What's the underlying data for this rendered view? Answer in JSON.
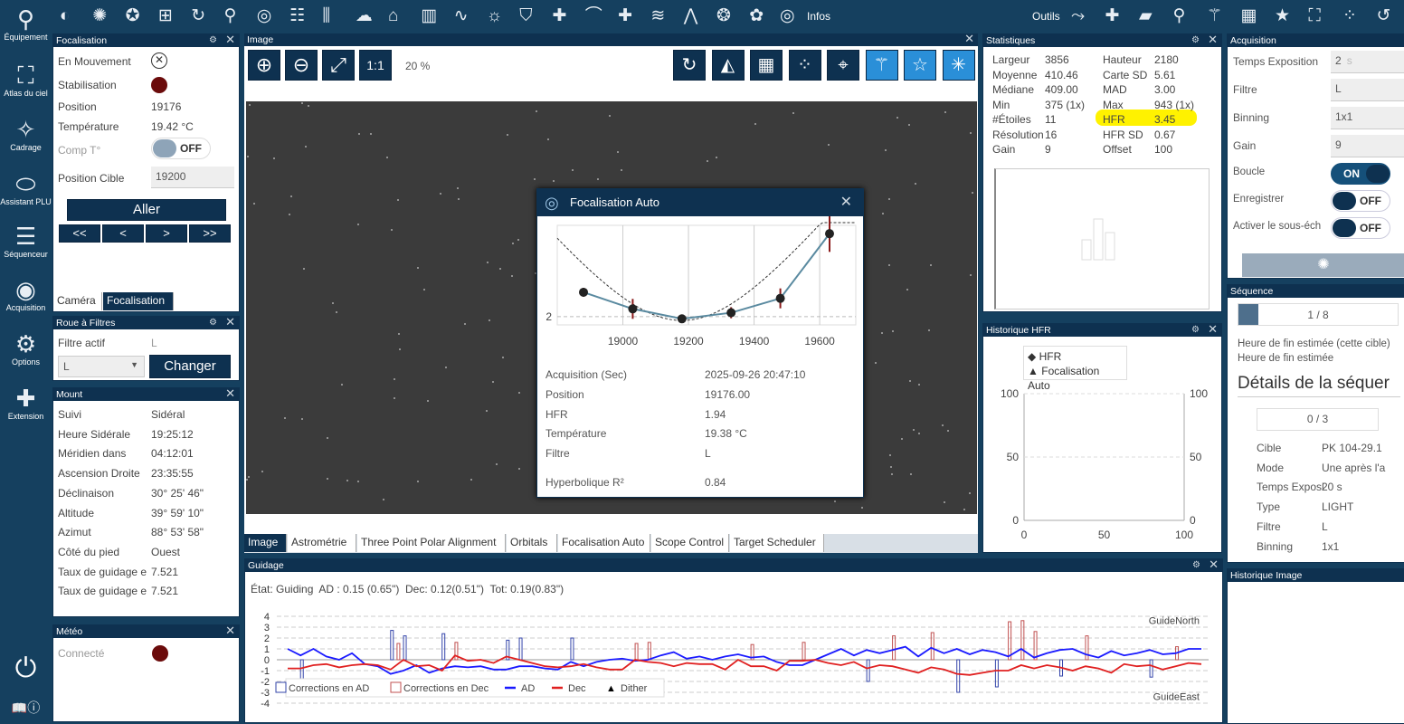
{
  "colors": {
    "navy": "#0e3150",
    "sidebar": "#15405f",
    "ad": "#1a1aff",
    "dec": "#e02020",
    "highlight": "#fff200",
    "fail": "#6b0b0b"
  },
  "sidebar": {
    "items": [
      {
        "label": "Équipement",
        "icon": "telescope-icon",
        "glyph": "⚲"
      },
      {
        "label": "Atlas du ciel",
        "icon": "map-icon",
        "glyph": "⛶"
      },
      {
        "label": "Cadrage",
        "icon": "stars-icon",
        "glyph": "✧"
      },
      {
        "label": "Assistant PLU",
        "icon": "flat-panel-icon",
        "glyph": "⬭"
      },
      {
        "label": "Séquenceur",
        "icon": "list-stars-icon",
        "glyph": "☰"
      },
      {
        "label": "Acquisition",
        "icon": "constellation-icon",
        "glyph": "◉"
      },
      {
        "label": "Options",
        "icon": "gears-icon",
        "glyph": "⚙"
      },
      {
        "label": "Extension",
        "icon": "puzzle-icon",
        "glyph": "✚"
      }
    ],
    "power": "⏻",
    "book": "📖",
    "info": "ⓘ"
  },
  "toolbar": {
    "left_icons": [
      {
        "name": "sky-icon",
        "glyph": "◐"
      },
      {
        "name": "shutter-icon",
        "glyph": "✺"
      },
      {
        "name": "filter-wheel-icon",
        "glyph": "✪"
      },
      {
        "name": "framing-icon",
        "glyph": "⊞"
      },
      {
        "name": "rotator-icon",
        "glyph": "↻"
      },
      {
        "name": "telescope-icon",
        "glyph": "⚲"
      },
      {
        "name": "guider-icon",
        "glyph": "◎"
      },
      {
        "name": "switch-list-icon",
        "glyph": "☷"
      },
      {
        "name": "sliders-icon",
        "glyph": "⫼"
      },
      {
        "name": "weather-icon",
        "glyph": "☁"
      },
      {
        "name": "dome-icon",
        "glyph": "⌂"
      },
      {
        "name": "chart-icon",
        "glyph": "▥"
      },
      {
        "name": "graph-icon",
        "glyph": "∿"
      },
      {
        "name": "bulb-icon",
        "glyph": "☼"
      },
      {
        "name": "shield-icon",
        "glyph": "⛉"
      },
      {
        "name": "plugin-icon",
        "glyph": "✚"
      },
      {
        "name": "curve-icon",
        "glyph": "⌒"
      },
      {
        "name": "puzzle-icon",
        "glyph": "✚"
      },
      {
        "name": "layers-icon",
        "glyph": "≋"
      },
      {
        "name": "horizon-icon",
        "glyph": "⋀"
      },
      {
        "name": "wheel-icon",
        "glyph": "❂"
      },
      {
        "name": "gear-flower-icon",
        "glyph": "✿"
      }
    ],
    "info_label": "Infos",
    "tools_label": "Outils",
    "right_icons": [
      {
        "name": "constellation-tool-icon",
        "glyph": "⤳"
      },
      {
        "name": "crosshair-tool-icon",
        "glyph": "✚"
      },
      {
        "name": "flat-tool-icon",
        "glyph": "▰"
      },
      {
        "name": "search-star-icon",
        "glyph": "⚲"
      },
      {
        "name": "wand-icon",
        "glyph": "⚚"
      },
      {
        "name": "calculator-icon",
        "glyph": "▦"
      },
      {
        "name": "star-icon",
        "glyph": "★"
      },
      {
        "name": "af-icon",
        "glyph": "⛶"
      },
      {
        "name": "star-field-icon",
        "glyph": "⁘"
      },
      {
        "name": "history-icon",
        "glyph": "↺"
      }
    ]
  },
  "focuser": {
    "title": "Focalisation",
    "rows": [
      {
        "label": "En Mouvement",
        "value": ""
      },
      {
        "label": "Stabilisation",
        "value": ""
      },
      {
        "label": "Position",
        "value": "19176"
      },
      {
        "label": "Température",
        "value": "19.42 °C"
      },
      {
        "label": "Comp T°",
        "value": ""
      },
      {
        "label": "Position Cible",
        "value": ""
      }
    ],
    "comp_toggle": "OFF",
    "target_value": "19200",
    "go_label": "Aller",
    "steps": [
      "<<",
      "<",
      ">",
      ">>"
    ],
    "tabs": [
      "Caméra",
      "Focalisation"
    ]
  },
  "filter_wheel": {
    "title": "Roue à Filtres",
    "active_label": "Filtre actif",
    "active_value": "L",
    "select_value": "L",
    "change_label": "Changer"
  },
  "mount": {
    "title": "Mount",
    "rows": [
      {
        "label": "Suivi",
        "value": "Sidéral"
      },
      {
        "label": "Heure Sidérale",
        "value": "19:25:12"
      },
      {
        "label": "Méridien dans",
        "value": "04:12:01"
      },
      {
        "label": "Ascension Droite",
        "value": "23:35:55"
      },
      {
        "label": "Déclinaison",
        "value": "30° 25' 46\""
      },
      {
        "label": "Altitude",
        "value": "39° 59' 10\""
      },
      {
        "label": "Azimut",
        "value": "88° 53' 58\""
      },
      {
        "label": "Côté du pied",
        "value": "Ouest"
      },
      {
        "label": "Taux de guidage e",
        "value": "7.521"
      },
      {
        "label": "Taux de guidage e",
        "value": "7.521"
      }
    ]
  },
  "weather": {
    "title": "Météo",
    "connected_label": "Connecté"
  },
  "image": {
    "title": "Image",
    "zoom": "20 %",
    "one_to_one": "1:1",
    "tabs": [
      "Image",
      "Astrométrie",
      "Three Point Polar Alignment",
      "Orbitals",
      "Focalisation Auto",
      "Scope Control",
      "Target Scheduler"
    ]
  },
  "autofocus": {
    "title": "Focalisation Auto",
    "details": [
      {
        "label": "Acquisition (Sec)",
        "value": "2025-09-26 20:47:10"
      },
      {
        "label": "Position",
        "value": "19176.00"
      },
      {
        "label": "HFR",
        "value": "1.94"
      },
      {
        "label": "Température",
        "value": "19.38 °C"
      },
      {
        "label": "Filtre",
        "value": "L"
      },
      {
        "label": "Hyperbolique R²",
        "value": "0.84"
      }
    ]
  },
  "stats": {
    "title": "Statistiques",
    "left": [
      [
        "Largeur",
        "3856"
      ],
      [
        "Moyenne",
        "410.46"
      ],
      [
        "Médiane",
        "409.00"
      ],
      [
        "Min",
        "375 (1x)"
      ],
      [
        "#Étoiles",
        "11"
      ],
      [
        "Résolution",
        "16"
      ],
      [
        "Gain",
        "9"
      ]
    ],
    "right": [
      [
        "Hauteur",
        "2180"
      ],
      [
        "Carte SD",
        "5.61"
      ],
      [
        "MAD",
        "3.00"
      ],
      [
        "Max",
        "943 (1x)"
      ],
      [
        "HFR",
        "3.45"
      ],
      [
        "HFR SD",
        "0.67"
      ],
      [
        "Offset",
        "100"
      ]
    ]
  },
  "hfr_history": {
    "title": "Historique HFR",
    "legend": [
      "HFR",
      "Focalisation Auto"
    ]
  },
  "acquisition": {
    "title": "Acquisition",
    "rows": [
      {
        "label": "Temps Exposition",
        "value": "2",
        "unit": "s"
      },
      {
        "label": "Filtre",
        "value": "L"
      },
      {
        "label": "Binning",
        "value": "1x1"
      },
      {
        "label": "Gain",
        "value": "9"
      }
    ],
    "toggles": [
      {
        "label": "Boucle",
        "state": "ON"
      },
      {
        "label": "Enregistrer",
        "state": "OFF"
      },
      {
        "label": "Activer le sous-éch",
        "state": "OFF"
      }
    ]
  },
  "sequence": {
    "title": "Séquence",
    "progress": "1 / 8",
    "progress_fraction": 0.125,
    "end_target": "Heure de fin estimée (cette cible)",
    "end_all": "Heure de fin estimée",
    "details_title": "Détails de la séquer",
    "sub_progress": "0 / 3",
    "rows": [
      [
        "Cible",
        "PK 104-29.1"
      ],
      [
        "Mode",
        "Une après l'a"
      ],
      [
        "Temps Exposi",
        "20 s"
      ],
      [
        "Type",
        "LIGHT"
      ],
      [
        "Filtre",
        "L"
      ],
      [
        "Binning",
        "1x1"
      ]
    ]
  },
  "image_history": {
    "title": "Historique Image"
  },
  "guiding": {
    "title": "Guidage",
    "status": "État: Guiding  AD : 0.15 (0.65\")  Dec: 0.12(0.51\")  Tot: 0.19(0.83\")",
    "north": "GuideNorth",
    "east": "GuideEast",
    "legend": [
      "Corrections en AD",
      "Corrections en Dec",
      "AD",
      "Dec",
      "Dither"
    ]
  },
  "chart_data": [
    {
      "type": "scatter",
      "name": "autofocus",
      "x": [
        18880,
        19030,
        19180,
        19330,
        19480,
        19630
      ],
      "y": [
        2.44,
        2.14,
        1.96,
        2.07,
        2.33,
        3.5
      ],
      "err": [
        0.08,
        0.18,
        0.07,
        0.1,
        0.18,
        0.33
      ],
      "xticks": [
        19000,
        19200,
        19400,
        19600
      ],
      "yticks": [
        "2"
      ],
      "xlim": [
        18800,
        19710
      ],
      "ylim": [
        1.85,
        3.65
      ]
    },
    {
      "type": "line",
      "name": "hfr-history",
      "xlim": [
        0,
        100
      ],
      "ylim": [
        0,
        100
      ],
      "xticks": [
        0,
        50,
        100
      ],
      "yticks": [
        0,
        50,
        100
      ]
    },
    {
      "type": "line",
      "name": "guiding",
      "ylim": [
        -4,
        4
      ],
      "yticks": [
        4,
        3,
        2,
        1,
        0,
        -1,
        -2,
        -3,
        -4
      ],
      "AD": [
        1.0,
        0.4,
        1.0,
        0.3,
        0,
        0.6,
        -0.4,
        -0.6,
        -1.3,
        -1,
        -0.5,
        -1.2,
        -0.8,
        -0.6,
        -0.7,
        -0.6,
        -0.9,
        -0.9,
        -0.6,
        -0.6,
        -0.8,
        -0.9,
        -0.2,
        -0.6,
        -0.2,
        0,
        0.1,
        -0.1,
        0,
        0.4,
        0.7,
        0.1,
        0.3,
        0,
        0.3,
        0.5,
        0.2,
        0.3,
        -0.2,
        -0.5,
        -0.5,
        0,
        0.5,
        1,
        0.4,
        0.9,
        0.6,
        0.9,
        1.2,
        0.3,
        1.1,
        0.6,
        1.0,
        0.5,
        0.9,
        0.7,
        0.3,
        1.0,
        0.2,
        0.6,
        0.9,
        1,
        0.5,
        0.2,
        0.8,
        0.4,
        0.6,
        0.9,
        0.5,
        0.6,
        1.0,
        1.0
      ],
      "Dec": [
        -0.8,
        -0.8,
        -0.5,
        -0.4,
        -0.7,
        -0.5,
        -0.4,
        -0.5,
        -0.9,
        0,
        -0.6,
        -0.5,
        -1,
        0.4,
        -0.1,
        0,
        -0.3,
        0.3,
        0,
        -0.3,
        -0.6,
        -0.7,
        -0.6,
        -0.4,
        -0.7,
        -0.9,
        -0.9,
        0,
        -0.2,
        -0.3,
        -0.6,
        -0.3,
        -0.4,
        -0.4,
        -0.9,
        0,
        -0.6,
        -0.6,
        -1,
        -0.1,
        -0.1,
        0,
        -0.3,
        -0.5,
        -0.2,
        -0.8,
        -0.5,
        -0.6,
        -0.9,
        -1.2,
        -0.7,
        -0.9,
        -1.3,
        -1.4,
        -1.2,
        -1.0,
        -1.0,
        -0.5,
        -0.8,
        -0.5,
        -0.7,
        -1.0,
        -0.6,
        -0.8,
        -1.2,
        -0.4,
        -0.6,
        -0.5,
        -0.9,
        -0.6,
        -0.3,
        -0.4
      ],
      "AD_corrections": [
        [
          1,
          -2
        ],
        [
          8,
          2.7
        ],
        [
          9,
          2.2
        ],
        [
          12,
          2.4
        ],
        [
          17,
          1.8
        ],
        [
          18,
          2
        ],
        [
          22,
          2
        ],
        [
          45,
          -2
        ],
        [
          52,
          -3
        ],
        [
          55,
          -2.5
        ],
        [
          60,
          -1.5
        ],
        [
          67,
          -1.6
        ]
      ],
      "Dec_corrections": [
        [
          8.5,
          1.5
        ],
        [
          13,
          1.6
        ],
        [
          27,
          1.5
        ],
        [
          28,
          1.6
        ],
        [
          36,
          1.4
        ],
        [
          40,
          1.6
        ],
        [
          47,
          2.2
        ],
        [
          50,
          2.5
        ],
        [
          56,
          3.5
        ],
        [
          57,
          3.6
        ],
        [
          58,
          2.6
        ],
        [
          62,
          2.2
        ],
        [
          69,
          1.2
        ]
      ]
    }
  ]
}
